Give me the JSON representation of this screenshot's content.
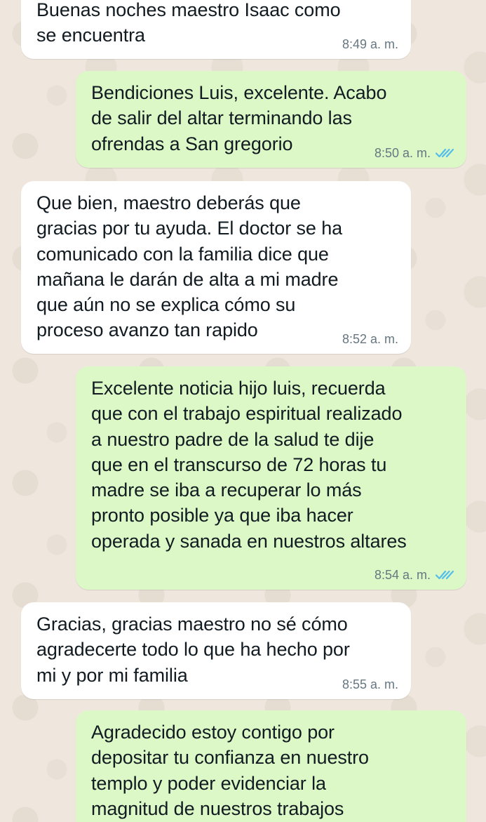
{
  "chat": {
    "colors": {
      "incoming_bubble": "#ffffff",
      "outgoing_bubble": "#dcf8c6",
      "timestamp": "#667781",
      "read_ticks": "#53bdeb"
    },
    "messages": [
      {
        "direction": "incoming",
        "text": "Buenas noches maestro Isaac como\nse encuentra",
        "time": "8:49 a. m."
      },
      {
        "direction": "outgoing",
        "text": "Bendiciones Luis, excelente. Acabo\nde salir del altar terminando las\nofrendas a San gregorio",
        "time": "8:50 a. m.",
        "status_icon": "double-check-read-icon"
      },
      {
        "direction": "incoming",
        "text": "Que bien, maestro deberás que\ngracias por tu ayuda. El doctor se ha\ncomunicado con la familia dice que\nmañana le darán de alta a mi madre\nque aún no se explica cómo su\nproceso avanzo tan rapido",
        "time": "8:52 a. m."
      },
      {
        "direction": "outgoing",
        "text": "Excelente noticia hijo luis, recuerda\nque con el trabajo espiritual realizado\na nuestro padre de la salud te dije\nque en el transcurso de 72 horas tu\nmadre se iba a recuperar lo más\npronto posible ya que iba hacer\noperada y sanada en nuestros altares",
        "time": "8:54 a. m.",
        "status_icon": "double-check-read-icon"
      },
      {
        "direction": "incoming",
        "text": "Gracias, gracias maestro no sé cómo\nagradecerte todo lo que ha hecho por\nmi y por mi familia",
        "time": "8:55 a. m."
      },
      {
        "direction": "outgoing",
        "text": "Agradecido estoy contigo por\ndepositar tu confianza en nuestro\ntemplo y poder evidenciar la\nmagnitud de nuestros trabajos",
        "time": ""
      }
    ]
  }
}
